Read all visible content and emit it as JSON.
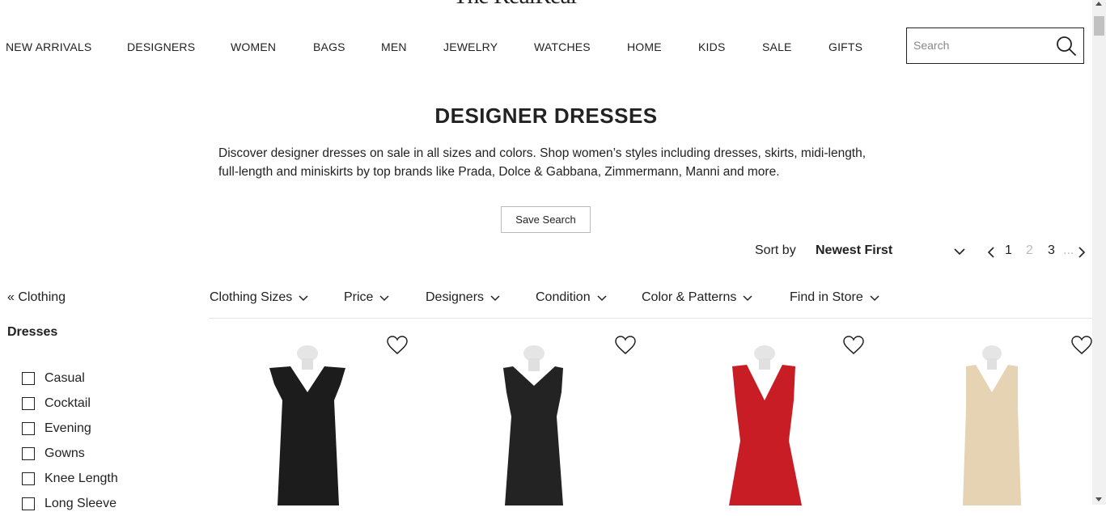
{
  "logo": "The RealReal",
  "nav": {
    "items": [
      "NEW ARRIVALS",
      "DESIGNERS",
      "WOMEN",
      "BAGS",
      "MEN",
      "JEWELRY",
      "WATCHES",
      "HOME",
      "KIDS",
      "SALE",
      "GIFTS"
    ]
  },
  "search": {
    "placeholder": "Search",
    "value": "",
    "icon": "search-icon"
  },
  "page": {
    "title": "DESIGNER DRESSES",
    "description": "Discover designer dresses on sale in all sizes and colors. Shop women’s styles including dresses, skirts, midi-length, full-length and miniskirts by top brands like Prada, Dolce & Gabbana, Zimmermann, Manni and more.",
    "save_search_label": "Save Search"
  },
  "sort": {
    "label": "Sort by",
    "value": "Newest First"
  },
  "pagination": {
    "pages": [
      "1",
      "2",
      "3"
    ],
    "current": "2",
    "ellipsis": "..."
  },
  "sidebar": {
    "back_link": "« Clothing",
    "heading": "Dresses",
    "filters": [
      "Casual",
      "Cocktail",
      "Evening",
      "Gowns",
      "Knee Length",
      "Long Sleeve"
    ]
  },
  "facets": [
    "Clothing Sizes",
    "Price",
    "Designers",
    "Condition",
    "Color & Patterns",
    "Find in Store"
  ],
  "products": [
    {
      "color": "#1c1c1c"
    },
    {
      "color": "#232323"
    },
    {
      "color": "#c81d25"
    },
    {
      "color": "#e6d3b3"
    }
  ]
}
